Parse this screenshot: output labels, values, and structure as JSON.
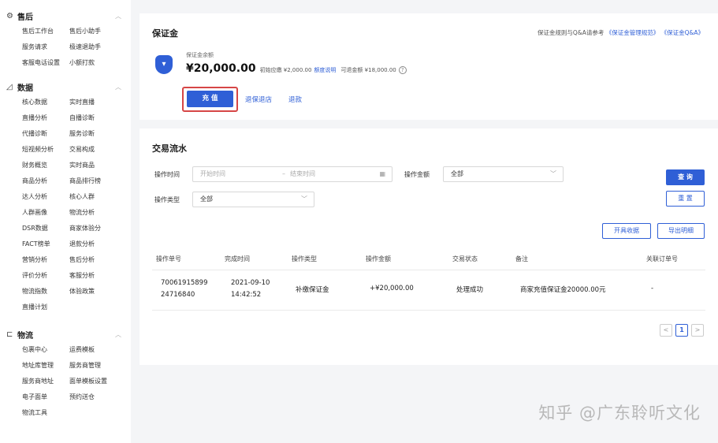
{
  "sidebar": {
    "groups": [
      {
        "icon": "gear-icon",
        "title": "售后",
        "items": [
          "售后工作台",
          "售后小助手",
          "服务请求",
          "极速退助手",
          "客服电话设置",
          "小额打款"
        ]
      },
      {
        "icon": "chart-icon",
        "title": "数据",
        "items": [
          "核心数据",
          "实时直播",
          "直播分析",
          "自播诊断",
          "代播诊断",
          "服务诊断",
          "短视频分析",
          "交易构成",
          "财务概览",
          "实时商品",
          "商品分析",
          "商品排行榜",
          "达人分析",
          "核心人群",
          "人群画像",
          "物流分析",
          "DSR数据",
          "商家体验分",
          "FACT榜单",
          "退款分析",
          "营销分析",
          "售后分析",
          "评价分析",
          "客服分析",
          "物流指数",
          "体验政策",
          "直播计划"
        ]
      },
      {
        "icon": "truck-icon",
        "title": "物流",
        "items": [
          "包裹中心",
          "运费模板",
          "地址库管理",
          "服务商管理",
          "服务商地址",
          "面单模板设置",
          "电子面单",
          "预约送仓",
          "物流工具"
        ]
      }
    ]
  },
  "deposit": {
    "title": "保证金",
    "rule_prefix": "保证金规则与Q&A请参考",
    "rule_link1": "《保证金管理规范》",
    "rule_link2": "《保证金Q&A》",
    "balance_label": "保证金余额",
    "balance": "¥20,000.00",
    "initial_due": "初始应缴 ¥2,000.00",
    "quota_link": "额度说明",
    "withdrawable": "可退金额 ¥18,000.00",
    "recharge_label": "充 值",
    "refund_store_label": "退保退店",
    "refund_label": "退款"
  },
  "flow": {
    "title": "交易流水",
    "filters": {
      "time_label": "操作时间",
      "start_placeholder": "开始时间",
      "separator": "–",
      "end_placeholder": "结束时间",
      "amount_label": "操作金额",
      "amount_value": "全部",
      "type_label": "操作类型",
      "type_value": "全部"
    },
    "query_label": "查 询",
    "reset_label": "重 置",
    "invoice_label": "开具收据",
    "export_label": "导出明细",
    "columns": [
      "操作单号",
      "完成时间",
      "操作类型",
      "操作金额",
      "交易状态",
      "备注",
      "关联订单号"
    ],
    "rows": [
      {
        "order_no_line1": "70061915899",
        "order_no_line2": "24716840",
        "time_line1": "2021-09-10",
        "time_line2": "14:42:52",
        "type": "补缴保证金",
        "amount": "+¥20,000.00",
        "status": "处理成功",
        "note": "商家充值保证金20000.00元",
        "related": "-"
      }
    ],
    "pagination": {
      "current": "1",
      "prev": "<",
      "next": ">"
    }
  },
  "watermark": "知乎 @广东聆听文化"
}
